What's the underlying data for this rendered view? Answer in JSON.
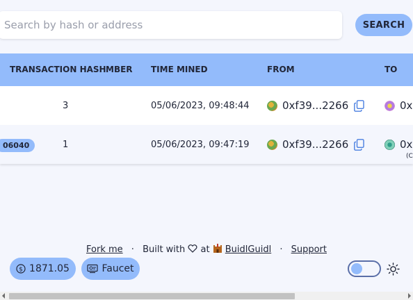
{
  "search": {
    "placeholder": "Search by hash or address",
    "button_label": "SEARCH"
  },
  "table": {
    "headers": {
      "hash": "TRANSACTION HASH",
      "block": "MBER",
      "time": "TIME MINED",
      "from": "FROM",
      "to": "TO"
    },
    "rows": [
      {
        "hash": "",
        "block": "3",
        "time": "05/06/2023, 09:48:44",
        "from": "0xf39...2266",
        "to": "0x",
        "to_sub": ""
      },
      {
        "hash": "06040",
        "block": "1",
        "time": "05/06/2023, 09:47:19",
        "from": "0xf39...2266",
        "to": "0x",
        "to_sub": "(C"
      }
    ]
  },
  "footer": {
    "fork": "Fork me",
    "built_with": "Built with",
    "at": "at",
    "buidl": "BuidlGuidl",
    "support": "Support",
    "sep": "·"
  },
  "wallet": {
    "balance": "1871.05",
    "faucet": "Faucet"
  },
  "colors": {
    "accent": "#93bbfb",
    "background": "#f4f6fd"
  },
  "icons": [
    "copy-icon",
    "dollar-icon",
    "faucet-icon",
    "heart-icon",
    "castle-icon",
    "sun-icon"
  ]
}
